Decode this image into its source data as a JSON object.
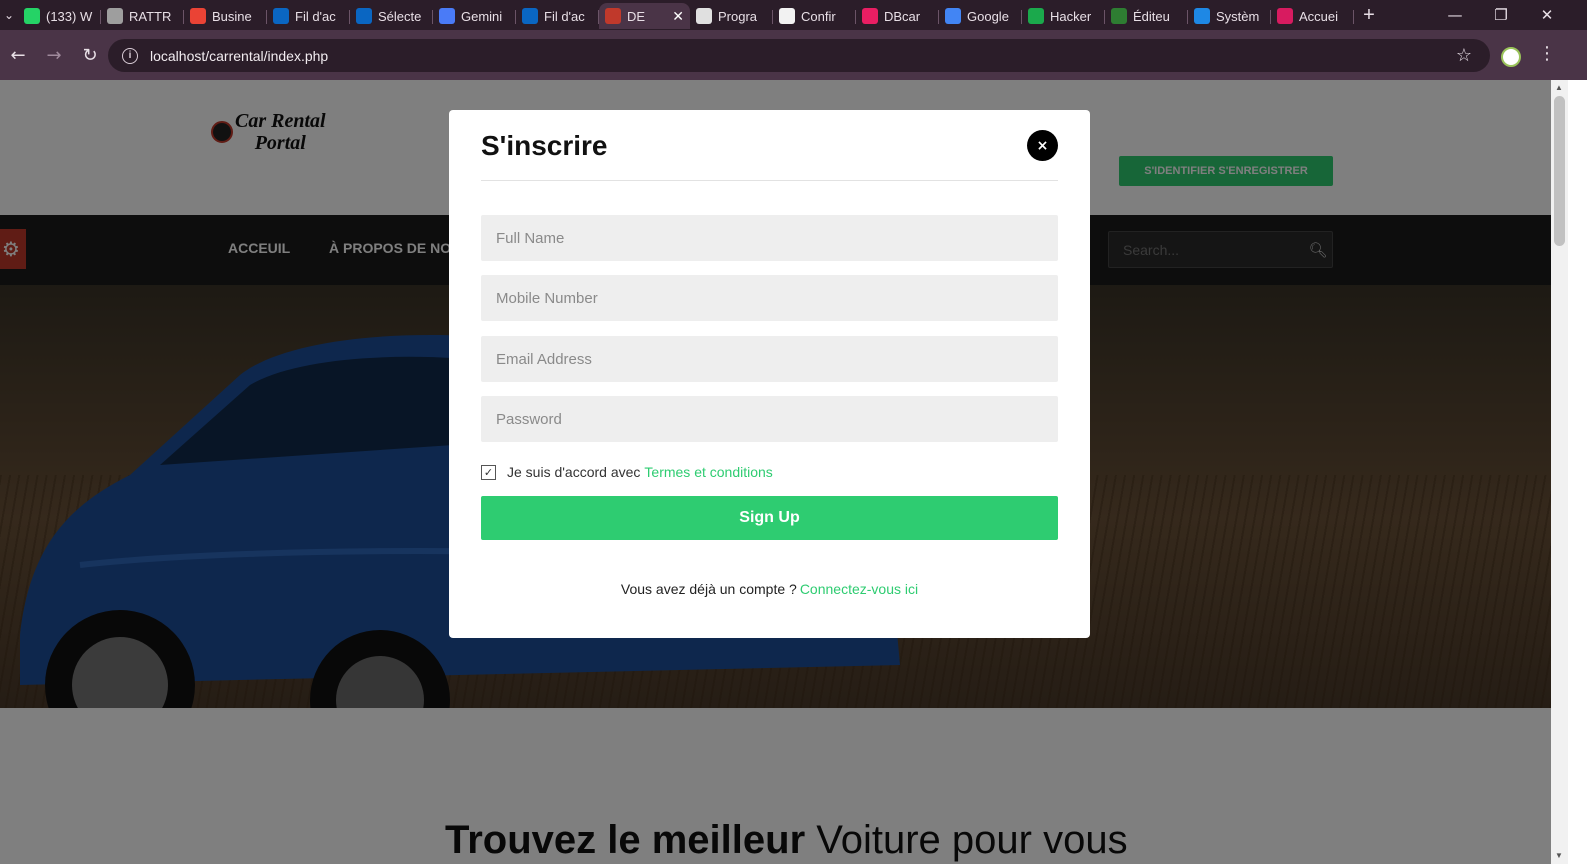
{
  "browser": {
    "tabs": [
      {
        "title": "(133) W",
        "icon": "whatsapp-icon",
        "color": "#25d366"
      },
      {
        "title": "RATTR",
        "icon": "globe-icon",
        "color": "#9e9e9e"
      },
      {
        "title": "Busine",
        "icon": "gmail-icon",
        "color": "#ea4335"
      },
      {
        "title": "Fil d'ac",
        "icon": "linkedin-icon",
        "color": "#0a66c2"
      },
      {
        "title": "Sélecte",
        "icon": "linkedin-icon",
        "color": "#0a66c2"
      },
      {
        "title": "Gemini",
        "icon": "gemini-icon",
        "color": "#4a7bf7"
      },
      {
        "title": "Fil d'ac",
        "icon": "linkedin-icon",
        "color": "#0a66c2"
      },
      {
        "title": "DE",
        "icon": "car-rental-icon",
        "color": "#c0392b",
        "active": true
      },
      {
        "title": "Progra",
        "icon": "document-icon",
        "color": "#e0e0e0"
      },
      {
        "title": "Confir",
        "icon": "c-icon",
        "color": "#f2f2f2"
      },
      {
        "title": "DBcar",
        "icon": "dbcar-icon",
        "color": "#e91e63"
      },
      {
        "title": "Google",
        "icon": "google-translate-icon",
        "color": "#4285f4"
      },
      {
        "title": "Hacker",
        "icon": "hackerrank-icon",
        "color": "#1ba94c"
      },
      {
        "title": "Éditeu",
        "icon": "editor-icon",
        "color": "#2e7d32"
      },
      {
        "title": "Systèm",
        "icon": "system-icon",
        "color": "#1e88e5"
      },
      {
        "title": "Accuei",
        "icon": "accueil-icon",
        "color": "#d81b60"
      }
    ],
    "url": "localhost/carrental/index.php",
    "colors": {
      "tabstrip": "#2b1d29",
      "toolbar": "#4a3447"
    }
  },
  "site": {
    "logo_line1": "Car Rental",
    "logo_line2": "Portal",
    "auth_button": "S'IDENTIFIER S'ENREGISTRER",
    "nav": [
      "ACCEUIL",
      "À PROPOS DE NOUS"
    ],
    "search_placeholder": "Search...",
    "headline_bold": "Trouvez le meilleur",
    "headline_light": "Voiture pour vous",
    "accent_color": "#2ecc71"
  },
  "modal": {
    "title": "S'inscrire",
    "close_symbol": "×",
    "fields": {
      "full_name": "Full Name",
      "mobile": "Mobile Number",
      "email": "Email Address",
      "password": "Password"
    },
    "terms_text": "Je suis d'accord avec",
    "terms_link": "Termes et conditions",
    "terms_checked": true,
    "signup_button": "Sign Up",
    "login_prompt": "Vous avez déjà un compte ?",
    "login_link": "Connectez-vous ici"
  }
}
